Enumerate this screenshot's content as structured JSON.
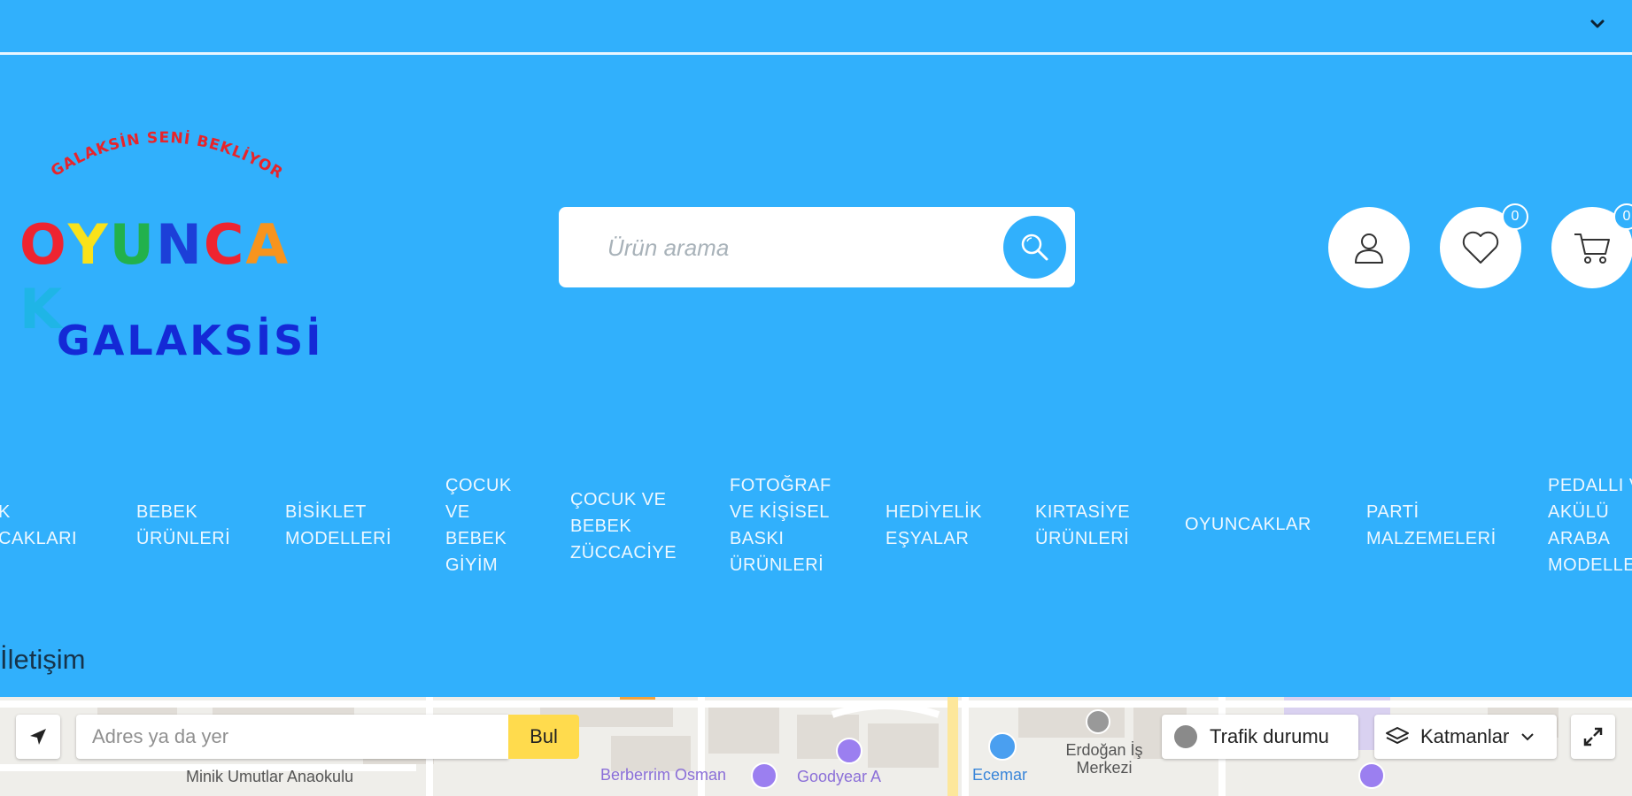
{
  "logo": {
    "tagline": "GALAKSİN SENİ BEKLİYOR",
    "word1_letters": [
      {
        "ch": "O",
        "color": "#ee2430"
      },
      {
        "ch": "Y",
        "color": "#f9e21a"
      },
      {
        "ch": "U",
        "color": "#22b14c"
      },
      {
        "ch": "N",
        "color": "#1c3fd8"
      },
      {
        "ch": "C",
        "color": "#ee2430"
      },
      {
        "ch": "A",
        "color": "#f7941d"
      },
      {
        "ch": "K",
        "color": "#1fb5e6"
      }
    ],
    "word2": "GALAKSİSİ",
    "tagline_color": "#e8242a",
    "word2_color": "#1429d6"
  },
  "search": {
    "placeholder": "Ürün arama",
    "button_icon": "search-icon"
  },
  "header_icons": {
    "account_icon": "user-icon",
    "wishlist_icon": "heart-icon",
    "wishlist_count": "0",
    "cart_icon": "cart-icon",
    "cart_count": "0"
  },
  "nav": {
    "items": [
      "K\nCAKLARI",
      "BEBEK\nÜRÜNLERİ",
      "BİSİKLET\nMODELLERİ",
      "ÇOCUK\nVE\nBEBEK\nGİYİM",
      "ÇOCUK VE\nBEBEK\nZÜCCACİYE",
      "FOTOĞRAF\nVE KİŞİSEL\nBASKI\nÜRÜNLERİ",
      "HEDİYELİK\nEŞYALAR",
      "KIRTASİYE\nÜRÜNLERİ",
      "OYUNCAKLAR",
      "PARTİ\nMALZEMELERİ",
      "PEDALLI VE\nAKÜLÜ\nARABA\nMODELLERİ"
    ]
  },
  "section": {
    "title": "İletişim"
  },
  "map": {
    "address_placeholder": "Adres ya da yer",
    "find_label": "Bul",
    "traffic_label": "Trafik durumu",
    "layers_label": "Katmanlar",
    "pois": [
      "Minik Umutlar Anaokulu",
      "Berberrim Osman",
      "Goodyear A",
      "Ecemar",
      "Erdoğan İş Merkezi"
    ]
  },
  "colors": {
    "brand_blue": "#31b0fc",
    "map_bg": "#efeeea",
    "find_button": "#ffdb4d"
  }
}
